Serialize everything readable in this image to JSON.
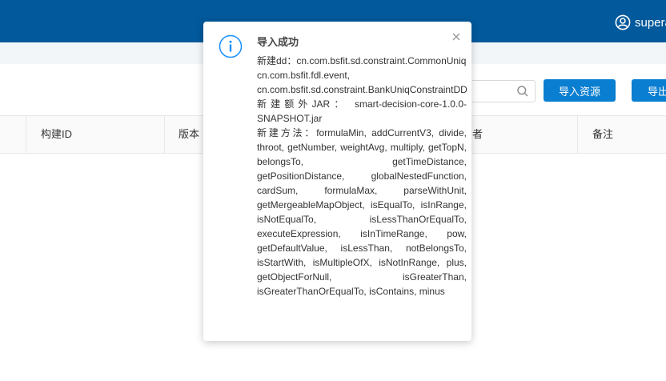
{
  "header": {
    "username": "supera"
  },
  "toolbar": {
    "import_label": "导入资源",
    "export_label": "导出"
  },
  "table": {
    "columns": [
      "构建ID",
      "版本",
      "者",
      "备注"
    ]
  },
  "notification": {
    "title": "导入成功",
    "line1": "新建dd：cn.com.bsfit.sd.constraint.CommonUniqConstraintDD",
    "line2": "cn.com.bsfit.fdl.event,",
    "line3": "cn.com.bsfit.sd.constraint.BankUniqConstraintDD",
    "line4": "新建额外JAR： smart-decision-core-1.0.0-SNAPSHOT.jar",
    "line5": "新建方法：formulaMin, addCurrentV3, divide, throot, getNumber, weightAvg, multiply, getTopN, belongsTo, getTimeDistance, getPositionDistance, globalNestedFunction, cardSum, formulaMax, parseWithUnit, getMergeableMapObject, isEqualTo, isInRange, isNotEqualTo, isLessThanOrEqualTo, executeExpression, isInTimeRange, pow, getDefaultValue, isLessThan, notBelongsTo, isStartWith, isMultipleOfX, isNotInRange, plus, getObjectForNull, isGreaterThan, isGreaterThanOrEqualTo, isContains, minus"
  },
  "colors": {
    "header_bg": "#02599b",
    "primary": "#0a7ed0",
    "info": "#1890ff"
  }
}
